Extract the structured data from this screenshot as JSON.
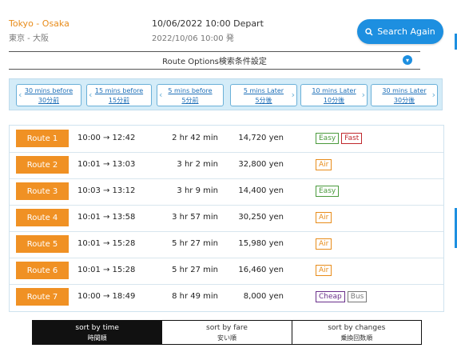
{
  "header": {
    "origin": "Tokyo",
    "separator": " - ",
    "destination": "Osaka",
    "route_jp": "東京 - 大阪",
    "datetime": "10/06/2022 10:00 Depart",
    "datetime_jp": "2022/10/06 10:00 発",
    "search_label": "Search Again"
  },
  "options": {
    "label": "Route Options検索条件設定"
  },
  "time_nav": [
    {
      "en": "30 mins before",
      "jp": "30分前"
    },
    {
      "en": "15 mins before",
      "jp": "15分前"
    },
    {
      "en": "5 mins before",
      "jp": "5分前"
    },
    {
      "en": "5 mins Later",
      "jp": "5分後"
    },
    {
      "en": "10 mins Later",
      "jp": "10分後"
    },
    {
      "en": "30 mins Later",
      "jp": "30分後"
    }
  ],
  "routes": [
    {
      "label": "Route 1",
      "time": "10:00 → 12:42",
      "duration": "2 hr 42 min",
      "fare": "14,720 yen",
      "tags": [
        "Easy",
        "Fast"
      ]
    },
    {
      "label": "Route 2",
      "time": "10:01 → 13:03",
      "duration": "3 hr 2 min",
      "fare": "32,800 yen",
      "tags": [
        "Air"
      ]
    },
    {
      "label": "Route 3",
      "time": "10:03 → 13:12",
      "duration": "3 hr 9 min",
      "fare": "14,400 yen",
      "tags": [
        "Easy"
      ]
    },
    {
      "label": "Route 4",
      "time": "10:01 → 13:58",
      "duration": "3 hr 57 min",
      "fare": "30,250 yen",
      "tags": [
        "Air"
      ]
    },
    {
      "label": "Route 5",
      "time": "10:01 → 15:28",
      "duration": "5 hr 27 min",
      "fare": "15,980 yen",
      "tags": [
        "Air"
      ]
    },
    {
      "label": "Route 6",
      "time": "10:01 → 15:28",
      "duration": "5 hr 27 min",
      "fare": "16,460 yen",
      "tags": [
        "Air"
      ]
    },
    {
      "label": "Route 7",
      "time": "10:00 → 18:49",
      "duration": "8 hr 49 min",
      "fare": "8,000 yen",
      "tags": [
        "Cheap",
        "Bus"
      ]
    }
  ],
  "sort": [
    {
      "en": "sort by time",
      "jp": "時間順",
      "active": true
    },
    {
      "en": "sort by fare",
      "jp": "安い順",
      "active": false
    },
    {
      "en": "sort by changes",
      "jp": "乗換回数順",
      "active": false
    }
  ],
  "colors": {
    "accent": "#1d8fe0",
    "route_button": "#f09124"
  }
}
